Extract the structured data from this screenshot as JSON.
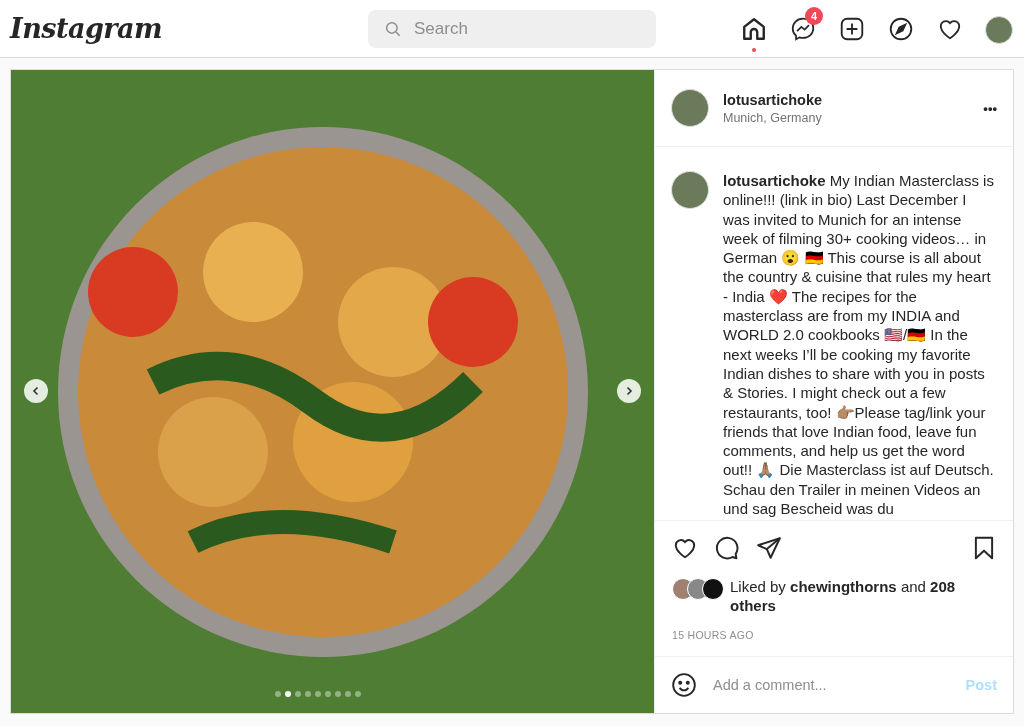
{
  "header": {
    "logo": "Instagram",
    "search": {
      "placeholder": "Search"
    },
    "nav": [
      {
        "kind": "home",
        "selected": true
      },
      {
        "kind": "messages",
        "badge": "4",
        "selected": false
      },
      {
        "kind": "new-post",
        "selected": false
      },
      {
        "kind": "explore",
        "selected": false
      },
      {
        "kind": "activity",
        "selected": false
      },
      {
        "kind": "profile",
        "selected": false
      }
    ]
  },
  "post": {
    "carousel": {
      "dots": [
        {
          "selected": false
        },
        {
          "selected": true
        },
        {
          "selected": false
        },
        {
          "selected": false
        },
        {
          "selected": false
        },
        {
          "selected": false
        },
        {
          "selected": false
        },
        {
          "selected": false
        },
        {
          "selected": false
        }
      ]
    },
    "author": {
      "username": "lotusartichoke",
      "location": "Munich, Germany",
      "menu": "•••"
    },
    "caption": "**lotusartichoke** My Indian Masterclass is online!!! (link in bio) Last December I was invited to Munich for an intense week of filming 30+ cooking videos… in German 😮 🇩🇪 This course is all about the country & cuisine that rules my heart - India ❤️ The recipes for the masterclass are from my INDIA and WORLD 2.0 cookbooks 🇺🇸/🇩🇪 In the next weeks I’ll be cooking my favorite Indian dishes to share with you in posts & Stories. I might check out a few restaurants, too! 👉🏽Please tag/link your friends that love Indian food, leave fun comments, and help us get the word out!! 🙏🏽 Die Masterclass ist auf Deutsch. Schau den Trailer in meinen Videos an und sag Bescheid was du",
    "liked": false,
    "saved": false,
    "likes": "Liked by **chewingthorns** and **208 others**",
    "time": "15 HOURS AGO",
    "comment": {
      "placeholder": "Add a comment...",
      "post": "Post",
      "disabled": true
    }
  }
}
